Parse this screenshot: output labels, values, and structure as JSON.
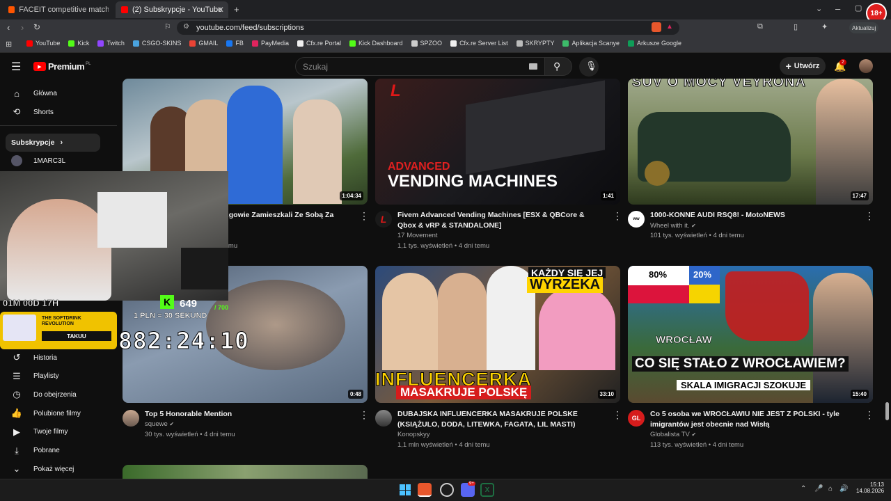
{
  "browser": {
    "tabs": [
      {
        "title": "FACEIT competitive match - FACEIT.c",
        "color": "#ff5500"
      },
      {
        "title": "(2) Subskrypcje - YouTube",
        "color": "#ff0000"
      }
    ],
    "url": "youtube.com/feed/subscriptions",
    "update_label": "Aktualizuj",
    "bookmarks": [
      {
        "label": "YouTube",
        "color": "#ff0000"
      },
      {
        "label": "Kick",
        "color": "#53fc18"
      },
      {
        "label": "Twitch",
        "color": "#9146ff"
      },
      {
        "label": "CSGO-SKINS",
        "color": "#4aa3df"
      },
      {
        "label": "GMAIL",
        "color": "#ea4335"
      },
      {
        "label": "FB",
        "color": "#1877f2"
      },
      {
        "label": "PayMedia",
        "color": "#e0245e"
      },
      {
        "label": "Cfx.re Portal",
        "color": "#f0f0f0"
      },
      {
        "label": "Kick Dashboard",
        "color": "#53fc18"
      },
      {
        "label": "SPZOO",
        "color": "#cccccc"
      },
      {
        "label": "Cfx.re Server List",
        "color": "#f0f0f0"
      },
      {
        "label": "SKRYPTY",
        "color": "#bbbbbb"
      },
      {
        "label": "Aplikacja Scanye",
        "color": "#3dbb6a"
      },
      {
        "label": "Arkusze Google",
        "color": "#0f9d58"
      }
    ]
  },
  "youtube": {
    "logo": "Premium",
    "logo_region": "PL",
    "search_placeholder": "Szukaj",
    "create_label": "Utwórz",
    "notifications": "2",
    "sidebar_top": [
      {
        "label": "Główna",
        "icon": "home-icon"
      },
      {
        "label": "Shorts",
        "icon": "shorts-icon"
      }
    ],
    "subscriptions_label": "Subskrypcje",
    "subscription_channel": "1MARC3L",
    "sidebar_you": [
      {
        "label": "Historia",
        "icon": "history-icon"
      },
      {
        "label": "Playlisty",
        "icon": "playlist-icon"
      },
      {
        "label": "Do obejrzenia",
        "icon": "watch-later-icon"
      },
      {
        "label": "Polubione filmy",
        "icon": "like-icon"
      },
      {
        "label": "Twoje filmy",
        "icon": "your-videos-icon"
      },
      {
        "label": "Pobrane",
        "icon": "download-icon"
      },
      {
        "label": "Pokaż więcej",
        "icon": "chevron-down-icon"
      }
    ],
    "videos": [
      {
        "title": "...gowie Zamieszkali Ze Sobą Za",
        "channel": "",
        "meta": "...mu",
        "duration": "1:04:34"
      },
      {
        "title": "Fivem Advanced Vending Machines [ESX & QBCore & Qbox & vRP & STANDALONE]",
        "channel": "17 Movement",
        "meta": "1,1 tys. wyświetleń • 4 dni temu",
        "duration": "1:41",
        "thumb_text": [
          "ADVANCED",
          "VENDING MACHINES"
        ]
      },
      {
        "title": "1000-KONNE AUDI RSQ8! - MotoNEWS",
        "channel": "Wheel with it.",
        "meta": "101 tys. wyświetleń • 4 dni temu",
        "duration": "17:47",
        "thumb_text": [
          "SUV O MOCY VEYRONA"
        ]
      },
      {
        "title": "Top 5 Honorable Mention",
        "channel": "squewe",
        "meta": "30 tys. wyświetleń • 4 dni temu",
        "duration": "0:48"
      },
      {
        "title": "DUBAJSKA INFLUENCERKA MASAKRUJE POLSKE (KSIĄŻULO, DODA, LITEWKA, FAGATA, LIL MASTI)",
        "channel": "Konopskyy",
        "meta": "1,1 mln wyświetleń • 4 dni temu",
        "duration": "33:10",
        "thumb_text": [
          "KAŻDY SIĘ JEJ",
          "WYRZEKA",
          "INFLUENCERKA",
          "MASAKRUJE POLSKĘ"
        ]
      },
      {
        "title": "Co 5 osoba we WROCŁAWIU NIE JEST Z POLSKI - tyle imigrantów jest obecnie nad Wisłą",
        "channel": "Globalista TV",
        "meta": "113 tys. wyświetleń • 4 dni temu",
        "duration": "15:40",
        "thumb_text": [
          "80%",
          "20%",
          "WROCŁAW",
          "CO SIĘ STAŁO Z WROCŁAWIEM?",
          "SKALA IMIGRACJI SZOKUJE"
        ]
      }
    ]
  },
  "overlay": {
    "timer_small": "01M 00D 17H",
    "kick_count": "649",
    "kick_goal": "/ 700",
    "rate": "1 PLN = 30 SEKUND",
    "timer_big": "882:24:10",
    "promo_title": "THE SOFTDRINK REVOLUTION",
    "promo_button": "TAKUU"
  },
  "taskbar": {
    "time": "15:13",
    "date": "14.08.2026",
    "badge": "9+"
  }
}
